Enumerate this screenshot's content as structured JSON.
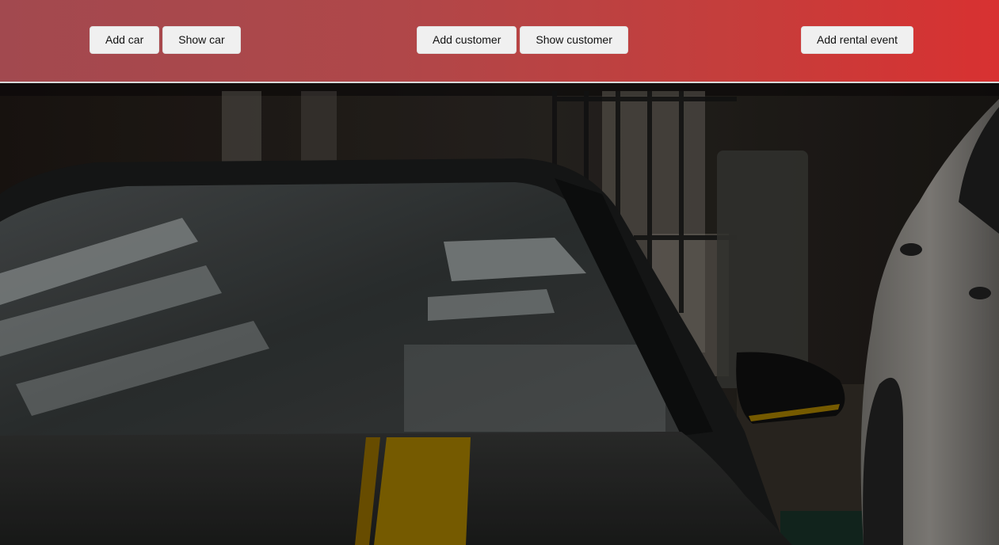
{
  "nav": {
    "car": {
      "add_label": "Add car",
      "show_label": "Show car"
    },
    "customer": {
      "add_label": "Add customer",
      "show_label": "Show customer"
    },
    "rental": {
      "add_label": "Add rental event"
    }
  },
  "hero": {
    "image": "dark-sports-car-photo",
    "overlay_color": "#000000"
  },
  "colors": {
    "header_gradient_start": "#a2494f",
    "header_gradient_end": "#d83131",
    "button_bg": "#f0f0f0",
    "stripe_yellow": "#8a6a00"
  }
}
